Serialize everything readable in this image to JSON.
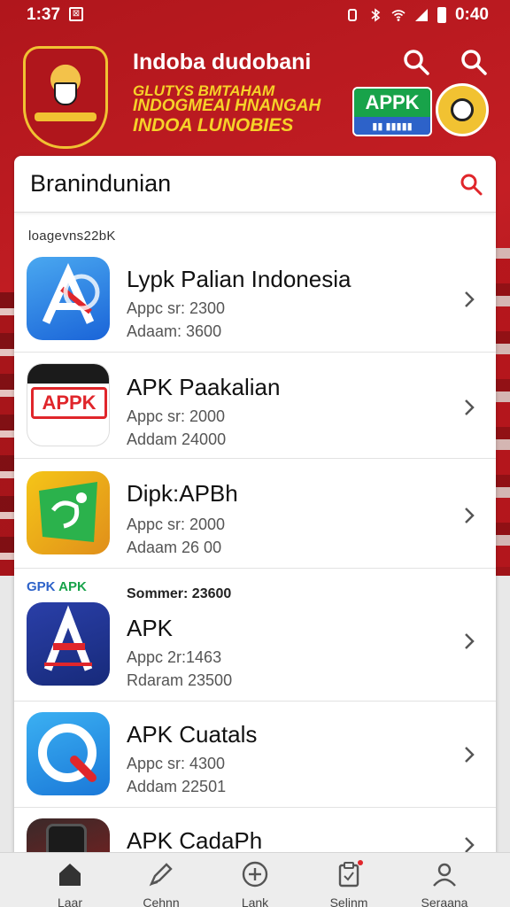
{
  "status_bar": {
    "time": "1:37",
    "sim_badge": "⊠",
    "clock_right": "0:40",
    "colors": {
      "text": "#ffffff"
    }
  },
  "header": {
    "title": "Indoba dudobani",
    "tagline_1": "GLUTYS BMTAHAM",
    "tagline_2": "INDOGMEAI HNANGAH",
    "tagline_3": "INDOA LUNOBIES",
    "apk_badge_top": "APPK",
    "apk_badge_bottom": "▮▮ ▮▮▮▮▮",
    "colors": {
      "primary_red": "#b0161c",
      "gold": "#f1c232",
      "tagline_yellow": "#f6d229"
    }
  },
  "search": {
    "query": "Branindunian",
    "icon": "search-icon",
    "icon_color": "#e0262b"
  },
  "section_1_label": "loagevns22bK",
  "section_2": {
    "brand_left": "GPK",
    "brand_right": "APK",
    "label": "Sommer: 23600"
  },
  "apps": [
    {
      "name": "Lypk Palian Indonesia",
      "meta1": "Appc sr: 2300",
      "meta2": "Adaam: 3600",
      "icon": "a-letter-icon"
    },
    {
      "name": "APK Paakalian",
      "meta1": "Appc sr: 2000",
      "meta2": "Addam 24000",
      "icon": "apk-text-icon"
    },
    {
      "name": "Dipk:APBh",
      "meta1": "Appc sr: 2000",
      "meta2": "Adaam 26 00",
      "icon": "leaf-map-icon"
    },
    {
      "name": "APK",
      "meta1": "Appc 2r:1463",
      "meta2": "Rdaram 23500",
      "icon": "a-arrow-icon"
    },
    {
      "name": "APK Cuatals",
      "meta1": "Appc sr: 4300",
      "meta2": "Addam 22501",
      "icon": "q-ring-icon"
    },
    {
      "name": "APK CadaPh",
      "meta1": "",
      "meta2": "",
      "icon": "phone-icon"
    }
  ],
  "bottom_nav": [
    {
      "label": "Laar",
      "icon": "home-icon"
    },
    {
      "label": "Cehnn",
      "icon": "pen-icon"
    },
    {
      "label": "Lank",
      "icon": "plus-circle-icon"
    },
    {
      "label": "Selinm",
      "icon": "clipboard-icon"
    },
    {
      "label": "Seraana",
      "icon": "user-icon"
    }
  ]
}
